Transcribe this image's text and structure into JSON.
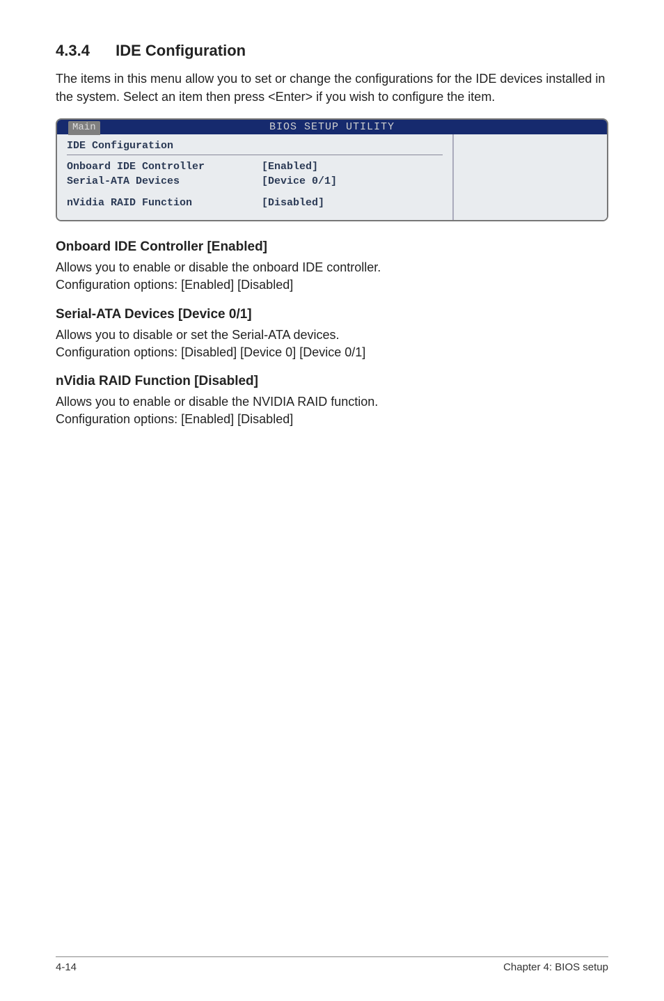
{
  "section": {
    "number": "4.3.4",
    "title": "IDE Configuration"
  },
  "intro": "The items in this menu allow you to set or change the configurations for the IDE devices installed in the system. Select an item then press <Enter> if you wish to configure the item.",
  "bios": {
    "header_title": "BIOS SETUP UTILITY",
    "tab": "Main",
    "group_header": "IDE Configuration",
    "rows": [
      {
        "k": "Onboard IDE Controller",
        "v": "[Enabled]"
      },
      {
        "k": "Serial-ATA Devices",
        "v": "[Device 0/1]"
      }
    ],
    "rows2": [
      {
        "k": "nVidia RAID Function",
        "v": "[Disabled]"
      }
    ]
  },
  "items": [
    {
      "title": "Onboard IDE Controller [Enabled]",
      "body": "Allows you to enable or disable the onboard IDE controller.\nConfiguration options: [Enabled] [Disabled]"
    },
    {
      "title": "Serial-ATA Devices [Device 0/1]",
      "body": "Allows you to disable or set the Serial-ATA devices.\nConfiguration options: [Disabled] [Device 0] [Device 0/1]"
    },
    {
      "title": "nVidia RAID Function [Disabled]",
      "body": "Allows you to enable or disable the NVIDIA RAID function.\nConfiguration options: [Enabled] [Disabled]"
    }
  ],
  "footer": {
    "left": "4-14",
    "right": "Chapter 4: BIOS setup"
  }
}
